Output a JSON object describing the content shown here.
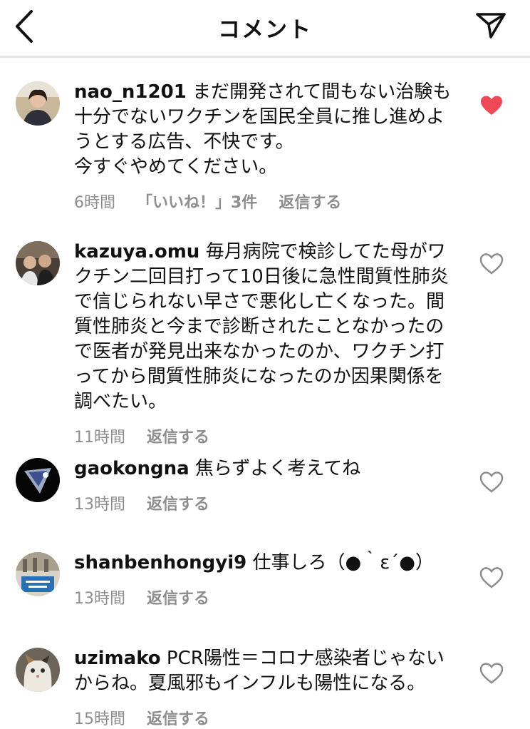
{
  "header": {
    "title": "コメント"
  },
  "colors": {
    "liked_heart": "#ed4956",
    "meta_text": "#8e8e8e"
  },
  "comments": [
    {
      "username": "nao_n1201",
      "text": "まだ開発されて間もない治験も十分でないワクチンを国民全員に推し進めようとする広告、不快です。\n今すぐやめてください。",
      "time": "6時間",
      "likes": "「いいね！」3件",
      "reply": "返信する",
      "liked": true
    },
    {
      "username": "kazuya.omu",
      "text": "毎月病院で検診してた母がワクチン二回目打って10日後に急性間質性肺炎で信じられない早さで悪化し亡くなった。間質性肺炎と今まで診断されたことなかったので医者が発見出来なかったのか、ワクチン打ってから間質性肺炎になったのか因果関係を調べたい。",
      "time": "11時間",
      "reply": "返信する",
      "liked": false
    },
    {
      "username": "gaokongna",
      "text": "焦らずよく考えてね",
      "time": "13時間",
      "reply": "返信する",
      "liked": false
    },
    {
      "username": "shanbenhongyi9",
      "text": "仕事しろ（●｀ε´●）",
      "time": "13時間",
      "reply": "返信する",
      "liked": false
    },
    {
      "username": "uzimako",
      "text": "PCR陽性＝コロナ感染者じゃないからね。夏風邪もインフルも陽性になる。",
      "time": "15時間",
      "reply": "返信する",
      "liked": false
    }
  ]
}
